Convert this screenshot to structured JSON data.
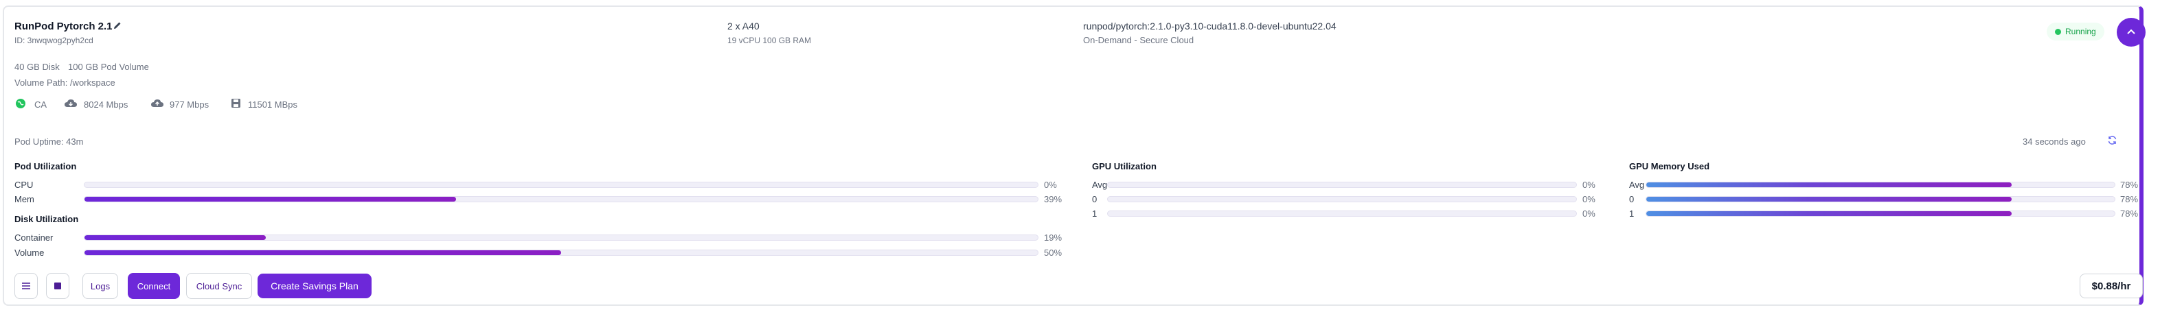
{
  "pod": {
    "name": "RunPod Pytorch 2.1",
    "id": "ID: 3nwqwog2pyh2cd",
    "gpu": "2 x A40",
    "specs": "19 vCPU 100 GB RAM",
    "image": "runpod/pytorch:2.1.0-py3.10-cuda11.8.0-devel-ubuntu22.04",
    "plan": "On-Demand - Secure Cloud",
    "status": "Running",
    "disk": "40 GB Disk",
    "volume": "100 GB Pod Volume",
    "volume_path": "Volume Path: /workspace",
    "region": "CA",
    "download": "8024 Mbps",
    "upload": "977 Mbps",
    "disk_speed": "11501 MBps",
    "uptime": "Pod Uptime: 43m",
    "updated": "34 seconds ago",
    "price": "$0.88/hr"
  },
  "pod_util": {
    "title": "Pod Utilization",
    "rows": [
      {
        "label": "CPU",
        "value": 0,
        "text": "0%"
      },
      {
        "label": "Mem",
        "value": 39,
        "text": "39%"
      }
    ]
  },
  "disk_util": {
    "title": "Disk Utilization",
    "rows": [
      {
        "label": "Container",
        "value": 19,
        "text": "19%"
      },
      {
        "label": "Volume",
        "value": 50,
        "text": "50%"
      }
    ]
  },
  "gpu_util": {
    "title": "GPU Utilization",
    "rows": [
      {
        "label": "Avg",
        "value": 0,
        "text": "0%"
      },
      {
        "label": "0",
        "value": 0,
        "text": "0%"
      },
      {
        "label": "1",
        "value": 0,
        "text": "0%"
      }
    ]
  },
  "gpu_mem": {
    "title": "GPU Memory Used",
    "rows": [
      {
        "label": "Avg",
        "value": 78,
        "text": "78%"
      },
      {
        "label": "0",
        "value": 78,
        "text": "78%"
      },
      {
        "label": "1",
        "value": 78,
        "text": "78%"
      }
    ]
  },
  "actions": {
    "logs": "Logs",
    "connect": "Connect",
    "cloud_sync": "Cloud Sync",
    "savings": "Create Savings Plan"
  },
  "icons": {
    "edit": "pencil-icon",
    "region": "globe-icon",
    "download": "cloud-download-icon",
    "upload": "cloud-upload-icon",
    "disk": "floppy-disk-icon",
    "refresh": "refresh-icon",
    "collapse": "chevron-up-icon",
    "menu": "menu-icon",
    "stop": "stop-icon"
  },
  "colors": {
    "accent": "#6d28d9",
    "running": "#16a34a",
    "gpu_mem_start": "#4f8fe3"
  }
}
